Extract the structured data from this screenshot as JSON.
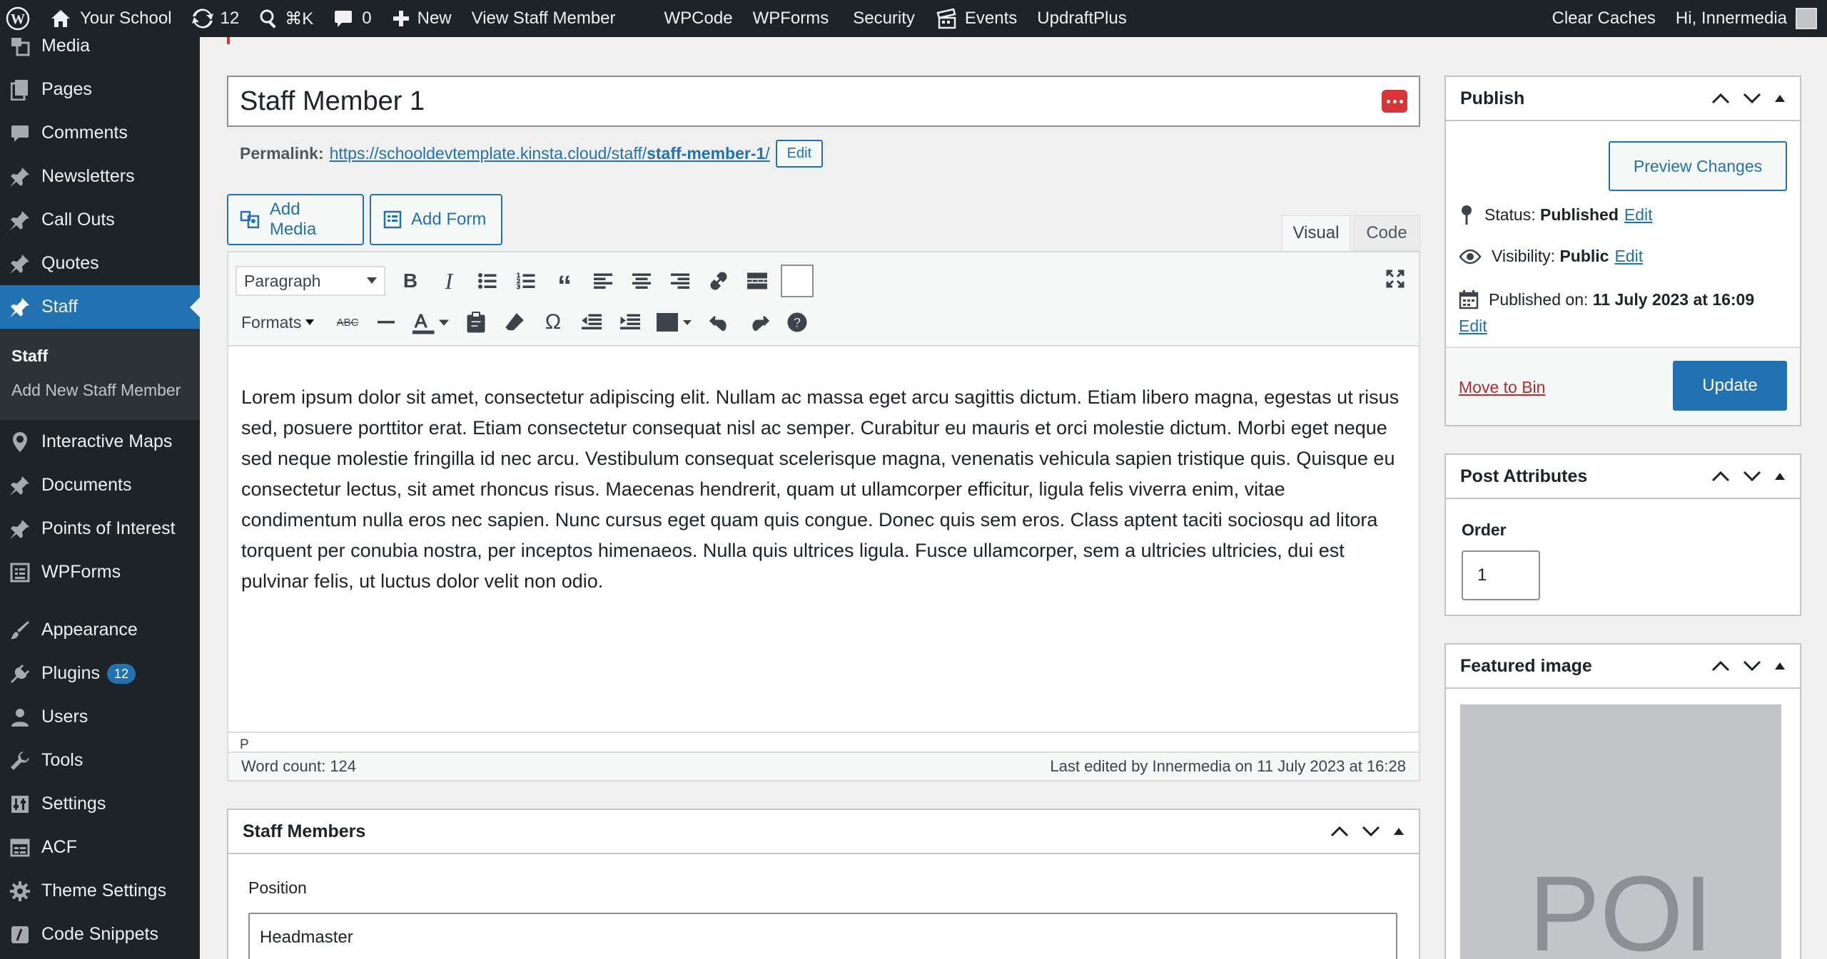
{
  "adminbar": {
    "site_name": "Your School",
    "updates_count": "12",
    "search_shortcut": "⌘K",
    "comments_count": "0",
    "new_label": "New",
    "view_label": "View Staff Member",
    "items": [
      "WPCode",
      "WPForms",
      "Security",
      "Events",
      "UpdraftPlus"
    ],
    "clear_caches": "Clear Caches",
    "greeting": "Hi, Innermedia"
  },
  "sidebar": {
    "items": [
      {
        "label": "Media",
        "icon": "media-icon"
      },
      {
        "label": "Pages",
        "icon": "pages-icon"
      },
      {
        "label": "Comments",
        "icon": "comments-icon"
      },
      {
        "label": "Newsletters",
        "icon": "pin-icon"
      },
      {
        "label": "Call Outs",
        "icon": "pin-icon"
      },
      {
        "label": "Quotes",
        "icon": "pin-icon"
      },
      {
        "label": "Staff",
        "icon": "pin-icon",
        "current": true
      }
    ],
    "submenu": [
      "Staff",
      "Add New Staff Member"
    ],
    "items2": [
      {
        "label": "Interactive Maps",
        "icon": "location-icon"
      },
      {
        "label": "Documents",
        "icon": "pin-icon"
      },
      {
        "label": "Points of Interest",
        "icon": "pin-icon"
      },
      {
        "label": "WPForms",
        "icon": "forms-icon"
      },
      {
        "label": "Appearance",
        "icon": "appearance-icon"
      },
      {
        "label": "Plugins",
        "icon": "plugins-icon",
        "badge": "12"
      },
      {
        "label": "Users",
        "icon": "users-icon"
      },
      {
        "label": "Tools",
        "icon": "tools-icon"
      },
      {
        "label": "Settings",
        "icon": "settings-icon"
      },
      {
        "label": "ACF",
        "icon": "acf-icon"
      },
      {
        "label": "Theme Settings",
        "icon": "gear-icon"
      },
      {
        "label": "Code Snippets",
        "icon": "code-icon"
      }
    ]
  },
  "post": {
    "title": "Staff Member 1",
    "permalink_label": "Permalink:",
    "permalink_url": "https://schooldevtemplate.kinsta.cloud/staff/staff-member-1/",
    "permalink_base": "https://schooldevtemplate.kinsta.cloud/staff/",
    "permalink_slug": "staff-member-1",
    "permalink_end": "/",
    "edit_label": "Edit"
  },
  "editor": {
    "add_media": "Add Media",
    "add_form": "Add Form",
    "tab_visual": "Visual",
    "tab_code": "Code",
    "paragraph_select": "Paragraph",
    "formats": "Formats",
    "content": "Lorem ipsum dolor sit amet, consectetur adipiscing elit. Nullam ac massa eget arcu sagittis dictum. Etiam libero magna, egestas ut risus sed, posuere porttitor erat. Etiam consectetur consequat nisl ac semper. Curabitur eu mauris et orci molestie dictum. Morbi eget neque sed neque molestie fringilla id nec arcu. Vestibulum consequat scelerisque magna, venenatis vehicula sapien tristique quis. Quisque eu consectetur lectus, sit amet rhoncus risus. Maecenas hendrerit, quam ut ullamcorper efficitur, ligula felis viverra enim, vitae condimentum nulla eros nec sapien. Nunc cursus eget quam quis congue. Donec quis sem eros. Class aptent taciti sociosqu ad litora torquent per conubia nostra, per inceptos himenaeos. Nulla quis ultrices ligula. Fusce ullamcorper, sem a ultricies ultricies, dui est pulvinar felis, ut luctus dolor velit non odio.",
    "path": "P",
    "word_count": "Word count: 124",
    "last_edited": "Last edited by Innermedia on 11 July 2023 at 16:28"
  },
  "staff_members_box": {
    "title": "Staff Members",
    "position_label": "Position",
    "position_value": "Headmaster"
  },
  "publish": {
    "title": "Publish",
    "preview": "Preview Changes",
    "status_label": "Status:",
    "status_value": "Published",
    "visibility_label": "Visibility:",
    "visibility_value": "Public",
    "published_label": "Published on:",
    "published_value": "11 July 2023 at 16:09",
    "edit": "Edit",
    "move_to_bin": "Move to Bin",
    "update": "Update"
  },
  "attributes": {
    "title": "Post Attributes",
    "order_label": "Order",
    "order_value": "1"
  },
  "featured": {
    "title": "Featured image",
    "image_text": "POI"
  },
  "colors": {
    "accent": "#2271b1",
    "dark": "#1d2327",
    "danger": "#d63638"
  }
}
